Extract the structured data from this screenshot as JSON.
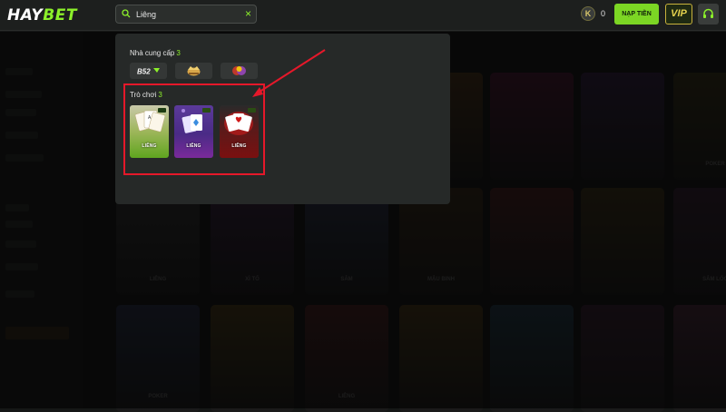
{
  "header": {
    "logo_part1": "HAY",
    "logo_part2": "BET",
    "search_value": "Liêng",
    "clear_icon": "×",
    "coin_symbol": "K",
    "balance": "0",
    "deposit_label": "NẠP TIỀN",
    "vip_label": "VIP"
  },
  "search_results": {
    "providers_title": "Nhà cung cấp",
    "providers_count": "3",
    "providers": [
      "B52",
      "royal-crown",
      "casino-club"
    ],
    "games_title": "Trò chơi",
    "games_count": "3",
    "games": [
      {
        "name": "LIÊNG",
        "theme": "green"
      },
      {
        "name": "LIÊNG",
        "theme": "purple"
      },
      {
        "name": "LIÊNG",
        "theme": "red"
      }
    ]
  },
  "background_tiles": [
    {
      "name": "",
      "color": "#3a2430"
    },
    {
      "name": "",
      "color": "#2c2133"
    },
    {
      "name": "",
      "color": "#3a2e22"
    },
    {
      "name": "",
      "color": "#3a2a1a"
    },
    {
      "name": "",
      "color": "#3a1a2a"
    },
    {
      "name": "",
      "color": "#2a1f35"
    },
    {
      "name": "POKER",
      "color": "#2e2a1a"
    },
    {
      "name": "LIÊNG",
      "color": "#2a2a2a"
    },
    {
      "name": "XÌ TỐ",
      "color": "#2d1f33"
    },
    {
      "name": "SÂM",
      "color": "#252a3a"
    },
    {
      "name": "MẬU BINH",
      "color": "#2e2418"
    },
    {
      "name": "",
      "color": "#3a1f1f"
    },
    {
      "name": "",
      "color": "#322a1a"
    },
    {
      "name": "SÂM LỐC",
      "color": "#2c1f2a"
    },
    {
      "name": "POKER",
      "color": "#232838"
    },
    {
      "name": "",
      "color": "#3a3018"
    },
    {
      "name": "LIÊNG",
      "color": "#3a1e1e"
    },
    {
      "name": "",
      "color": "#3a2e1a"
    },
    {
      "name": "",
      "color": "#20303a"
    },
    {
      "name": "",
      "color": "#2e1f2a"
    }
  ],
  "colors": {
    "accent": "#8cf02a",
    "highlight_box": "#e5182a",
    "arrow": "#e5182a"
  }
}
